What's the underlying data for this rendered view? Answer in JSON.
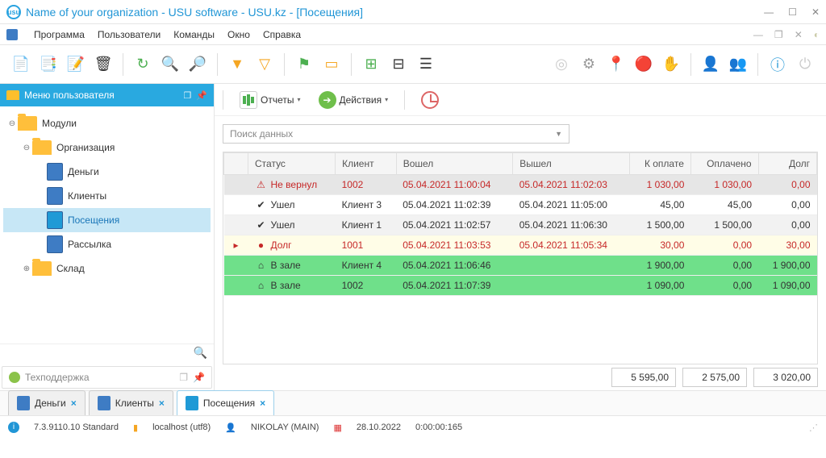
{
  "window": {
    "title": "Name of your organization - USU software - USU.kz - [Посещения]"
  },
  "menu": {
    "app": "Программа",
    "users": "Пользователи",
    "commands": "Команды",
    "window": "Окно",
    "help": "Справка"
  },
  "sidebar": {
    "header": "Меню пользователя",
    "modules": "Модули",
    "organization": "Организация",
    "items": {
      "money": "Деньги",
      "clients": "Клиенты",
      "visits": "Посещения",
      "mailing": "Рассылка"
    },
    "warehouse": "Склад",
    "support": "Техподдержка"
  },
  "actions": {
    "reports": "Отчеты",
    "actions": "Действия"
  },
  "search": {
    "placeholder": "Поиск данных"
  },
  "grid": {
    "cols": {
      "status": "Статус",
      "client": "Клиент",
      "in": "Вошел",
      "out": "Вышел",
      "topay": "К оплате",
      "paid": "Оплачено",
      "debt": "Долг"
    },
    "rows": [
      {
        "cls": "r-warn",
        "icon": "⚠",
        "status": "Не вернул",
        "client": "1002",
        "in": "05.04.2021 11:00:04",
        "out": "05.04.2021 11:02:03",
        "topay": "1 030,00",
        "paid": "1 030,00",
        "debt": "0,00"
      },
      {
        "cls": "",
        "icon": "✔",
        "status": "Ушел",
        "client": "Клиент 3",
        "in": "05.04.2021 11:02:39",
        "out": "05.04.2021 11:05:00",
        "topay": "45,00",
        "paid": "45,00",
        "debt": "0,00"
      },
      {
        "cls": "r-gray",
        "icon": "✔",
        "status": "Ушел",
        "client": "Клиент 1",
        "in": "05.04.2021 11:02:57",
        "out": "05.04.2021 11:06:30",
        "topay": "1 500,00",
        "paid": "1 500,00",
        "debt": "0,00"
      },
      {
        "cls": "r-debt",
        "mark": "▸",
        "icon": "●",
        "status": "Долг",
        "client": "1001",
        "in": "05.04.2021 11:03:53",
        "out": "05.04.2021 11:05:34",
        "topay": "30,00",
        "paid": "0,00",
        "debt": "30,00"
      },
      {
        "cls": "r-hall",
        "icon": "⌂",
        "status": "В зале",
        "client": "Клиент 4",
        "in": "05.04.2021 11:06:46",
        "out": "",
        "topay": "1 900,00",
        "paid": "0,00",
        "debt": "1 900,00"
      },
      {
        "cls": "r-hall",
        "icon": "⌂",
        "status": "В зале",
        "client": "1002",
        "in": "05.04.2021 11:07:39",
        "out": "",
        "topay": "1 090,00",
        "paid": "0,00",
        "debt": "1 090,00"
      }
    ],
    "totals": {
      "topay": "5 595,00",
      "paid": "2 575,00",
      "debt": "3 020,00"
    }
  },
  "tabs": [
    {
      "label": "Деньги",
      "active": false
    },
    {
      "label": "Клиенты",
      "active": false
    },
    {
      "label": "Посещения",
      "active": true
    }
  ],
  "status": {
    "version": "7.3.9110.10 Standard",
    "host": "localhost (utf8)",
    "user": "NIKOLAY (MAIN)",
    "date": "28.10.2022",
    "time": "0:00:00:165"
  }
}
